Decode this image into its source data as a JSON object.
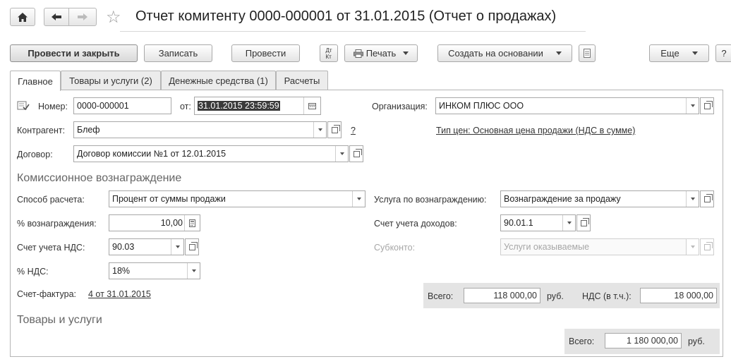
{
  "window": {
    "title": "Отчет комитенту 0000-000001 от 31.01.2015 (Отчет о продажах)"
  },
  "toolbar": {
    "post_close": "Провести и закрыть",
    "save": "Записать",
    "post": "Провести",
    "dtkt": "Дт Кт",
    "print": "Печать",
    "create_based": "Создать на основании",
    "more": "Еще",
    "help": "?"
  },
  "tabs": [
    {
      "label": "Главное"
    },
    {
      "label": "Товары и услуги (2)"
    },
    {
      "label": "Денежные средства (1)"
    },
    {
      "label": "Расчеты"
    }
  ],
  "form": {
    "number_label": "Номер:",
    "number_value": "0000-000001",
    "date_label": "от:",
    "date_value": "31.01.2015 23:59:59",
    "org_label": "Организация:",
    "org_value": "ИНКОМ ПЛЮС ООО",
    "counterparty_label": "Контрагент:",
    "counterparty_value": "Блеф",
    "question": "?",
    "price_type_link": "Тип цен: Основная цена продажи (НДС в сумме)",
    "contract_label": "Договор:",
    "contract_value": "Договор комиссии №1 от 12.01.2015"
  },
  "commission": {
    "section_title": "Комиссионное вознаграждение",
    "method_label": "Способ расчета:",
    "method_value": "Процент от суммы продажи",
    "service_label": "Услуга по вознаграждению:",
    "service_value": "Вознаграждение за продажу",
    "percent_label": "% вознаграждения:",
    "percent_value": "10,00",
    "income_label": "Счет учета доходов:",
    "income_value": "90.01.1",
    "vat_account_label": "Счет учета НДС:",
    "vat_account_value": "90.03",
    "subconto_label": "Субконто:",
    "subconto_value": "Услуги оказываемые",
    "vat_percent_label": "% НДС:",
    "vat_percent_value": "18%",
    "invoice_label": "Счет-фактура:",
    "invoice_link": "4 от 31.01.2015",
    "total_label": "Всего:",
    "total_value": "118 000,00",
    "currency": "руб.",
    "vat_incl_label": "НДС (в т.ч.):",
    "vat_incl_value": "18 000,00"
  },
  "goods": {
    "section_title": "Товары и услуги",
    "total_label": "Всего:",
    "total_value": "1 180 000,00",
    "currency": "руб."
  }
}
